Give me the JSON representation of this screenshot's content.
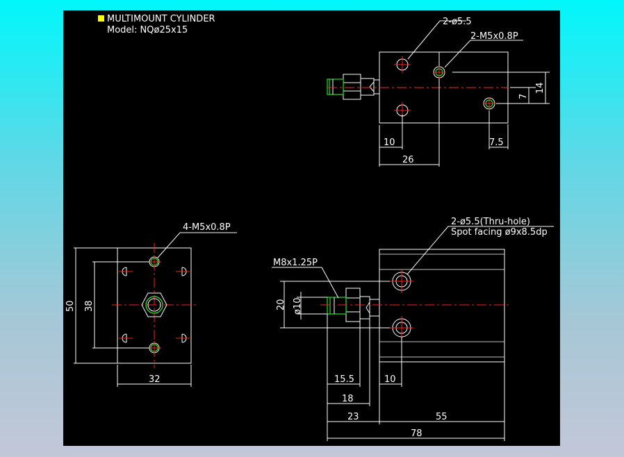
{
  "title": {
    "line1": "MULTIMOUNT CYLINDER",
    "line2": "Model: NQø25x15"
  },
  "colors": {
    "background": "#000000",
    "outline": "#ffffff",
    "centerline": "#ff2020",
    "thread": "#21e021",
    "marker": "#ffff00"
  },
  "top_view": {
    "hole_callout": "2-ø5.5",
    "port_callout": "2-M5x0.8P",
    "dim_10": "10",
    "dim_26": "26",
    "dim_7_5": "7.5",
    "dim_7": "7",
    "dim_14": "14"
  },
  "end_view": {
    "tap_callout": "4-M5x0.8P",
    "dim_50": "50",
    "dim_38": "38",
    "dim_32": "32"
  },
  "side_view": {
    "hole_callout_line1": "2-ø5.5(Thru-hole)",
    "hole_callout_line2": "Spot facing ø9x8.5dp",
    "rod_thread": "M8x1.25P",
    "dim_20": "20",
    "dim_d10": "ø10",
    "dim_15_5": "15.5",
    "dim_10": "10",
    "dim_18": "18",
    "dim_23": "23",
    "dim_55": "55",
    "dim_78": "78"
  }
}
